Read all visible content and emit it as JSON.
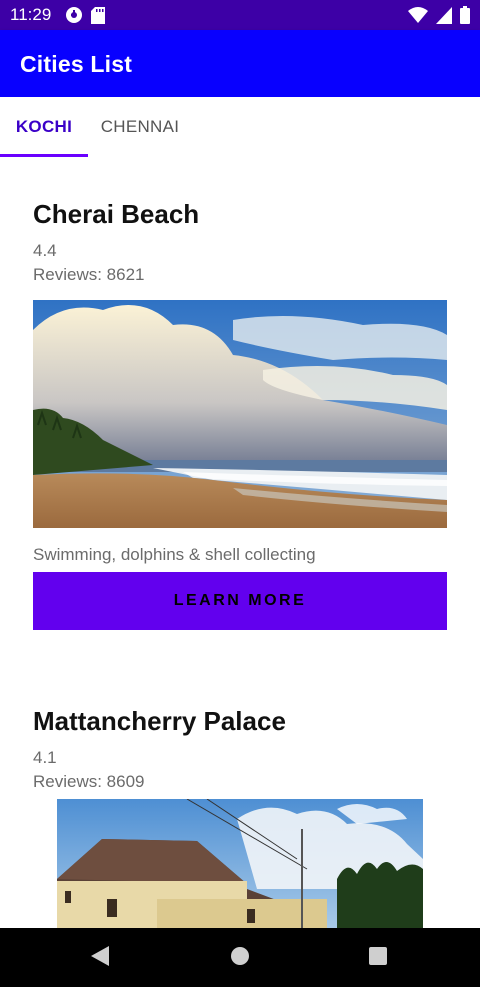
{
  "status_bar": {
    "time": "11:29",
    "icons": [
      "data-saver-icon",
      "sd-card-icon",
      "wifi-icon",
      "cell-signal-icon",
      "battery-icon"
    ]
  },
  "app_bar": {
    "title": "Cities List",
    "color": "#0800ff"
  },
  "tabs": [
    {
      "label": "KOCHI",
      "selected": true
    },
    {
      "label": "CHENNAI",
      "selected": false
    }
  ],
  "places": [
    {
      "name": "Cherai Beach",
      "rating": "4.4",
      "reviews": "Reviews: 8621",
      "description": "Swimming, dolphins & shell collecting",
      "button_label": "LEARN MORE"
    },
    {
      "name": "Mattancherry Palace",
      "rating": "4.1",
      "reviews": "Reviews: 8609"
    }
  ],
  "nav_bar": {
    "icons": [
      "back-icon",
      "home-icon",
      "recents-icon"
    ]
  },
  "colors": {
    "status_bar": "#3d00a6",
    "accent": "#6200ee",
    "tab_active": "#3b00c8"
  }
}
